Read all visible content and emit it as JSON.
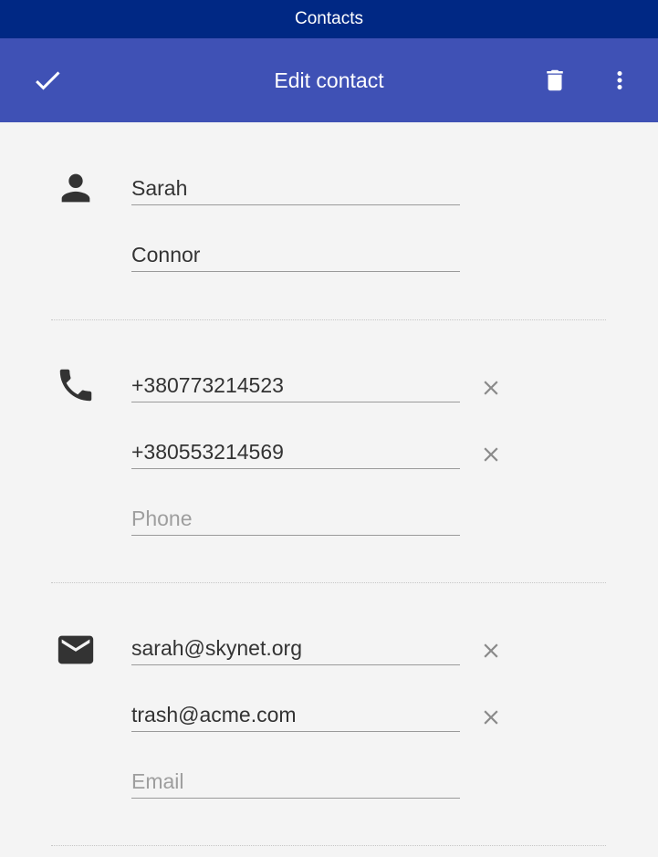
{
  "statusbar": {
    "app_name": "Contacts"
  },
  "toolbar": {
    "title": "Edit contact",
    "save_icon": "check-icon",
    "delete_icon": "trash-icon",
    "more_icon": "more-vert-icon"
  },
  "name": {
    "icon": "person-icon",
    "first": {
      "value": "Sarah",
      "placeholder": ""
    },
    "last": {
      "value": "Connor",
      "placeholder": ""
    }
  },
  "phones": {
    "icon": "phone-icon",
    "items": [
      {
        "value": "+380773214523"
      },
      {
        "value": "+380553214569"
      }
    ],
    "new": {
      "value": "",
      "placeholder": "Phone"
    }
  },
  "emails": {
    "icon": "email-icon",
    "items": [
      {
        "value": "sarah@skynet.org"
      },
      {
        "value": "trash@acme.com"
      }
    ],
    "new": {
      "value": "",
      "placeholder": "Email"
    }
  },
  "colors": {
    "statusbar": "#002884",
    "toolbar": "#3f51b5",
    "background": "#f4f4f4",
    "icon": "#333333",
    "clear_icon": "#8a8a8a",
    "placeholder": "#9e9e9e"
  }
}
